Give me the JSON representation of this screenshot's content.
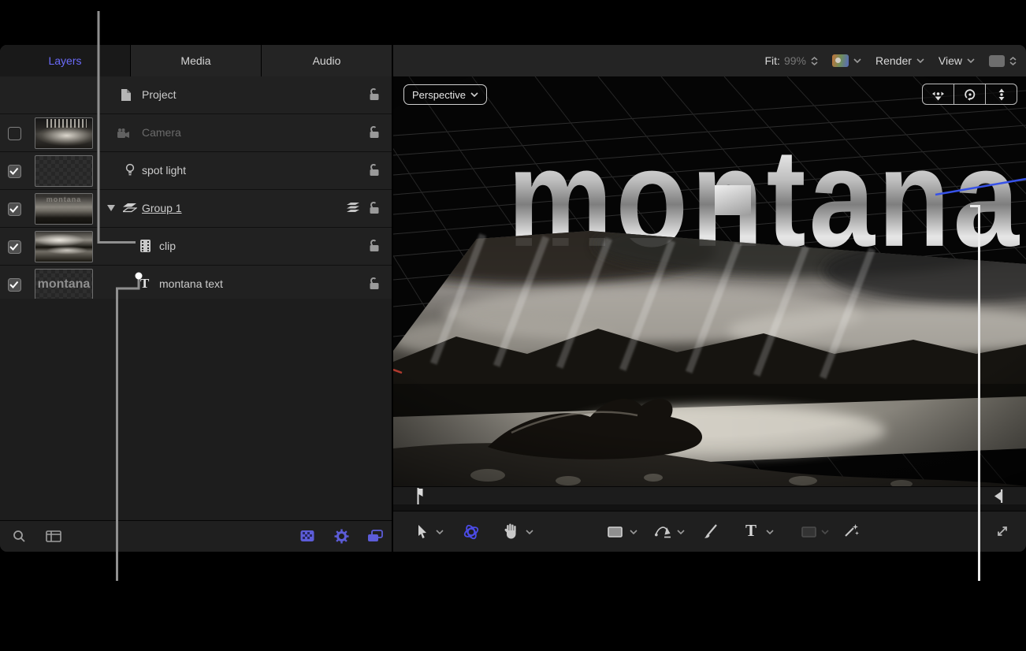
{
  "app": {
    "tabs": {
      "layers": "Layers",
      "media": "Media",
      "audio": "Audio"
    },
    "layers_list": {
      "rows": [
        {
          "name": "Project",
          "icon": "document-icon",
          "checkbox": "none",
          "locked": false
        },
        {
          "name": "Camera",
          "icon": "camera-icon",
          "checkbox": "unchecked",
          "locked": false,
          "dimmed": true
        },
        {
          "name": "spot light",
          "icon": "light-bulb-icon",
          "checkbox": "checked",
          "locked": false
        },
        {
          "name": "Group 1",
          "icon": "group-layers-icon",
          "checkbox": "checked",
          "locked": false,
          "selected": true,
          "expanded": true,
          "thumb_text": "montana"
        },
        {
          "name": "clip",
          "icon": "film-clip-icon",
          "checkbox": "checked",
          "locked": false,
          "indented": true
        },
        {
          "name": "montana text",
          "icon": "text-layer-icon",
          "checkbox": "checked",
          "locked": false,
          "indented": true,
          "thumb_text": "montana"
        }
      ]
    },
    "viewer": {
      "fit_label": "Fit:",
      "fit_value": "99%",
      "render_label": "Render",
      "view_label": "View",
      "camera_menu": "Perspective",
      "text_3d": "montana"
    },
    "icon_names": [
      "document-icon",
      "camera-icon",
      "light-bulb-icon",
      "disclosure-triangle-icon",
      "group-layers-icon",
      "film-clip-icon",
      "text-layer-icon",
      "lock-open-icon",
      "layer-stack-icon",
      "search-icon",
      "panel-layout-icon",
      "checkerboard-icon",
      "gear-icon",
      "layered-windows-icon",
      "select-arrow-icon",
      "orbit-3d-tool-icon",
      "hand-tool-icon",
      "shape-rect-tool-icon",
      "bezier-pen-tool-icon",
      "paint-brush-tool-icon",
      "text-tool-icon",
      "mask-rect-tool-icon",
      "adjust-wand-tool-icon",
      "resize-diagonal-icon",
      "pan-camera-icon",
      "orbit-camera-icon",
      "dolly-camera-icon",
      "color-swatch",
      "zoom-stepper",
      "play-range-start-marker",
      "play-range-end-marker",
      "chevron-down-icon"
    ],
    "colors": {
      "accent_blue": "#6b6bfa",
      "tool_blue": "#4b4be6",
      "panel_bg": "#212121",
      "canvas_bg": "#050505",
      "callout_gray": "#8f8f8f",
      "callout_white": "#ececec"
    }
  }
}
